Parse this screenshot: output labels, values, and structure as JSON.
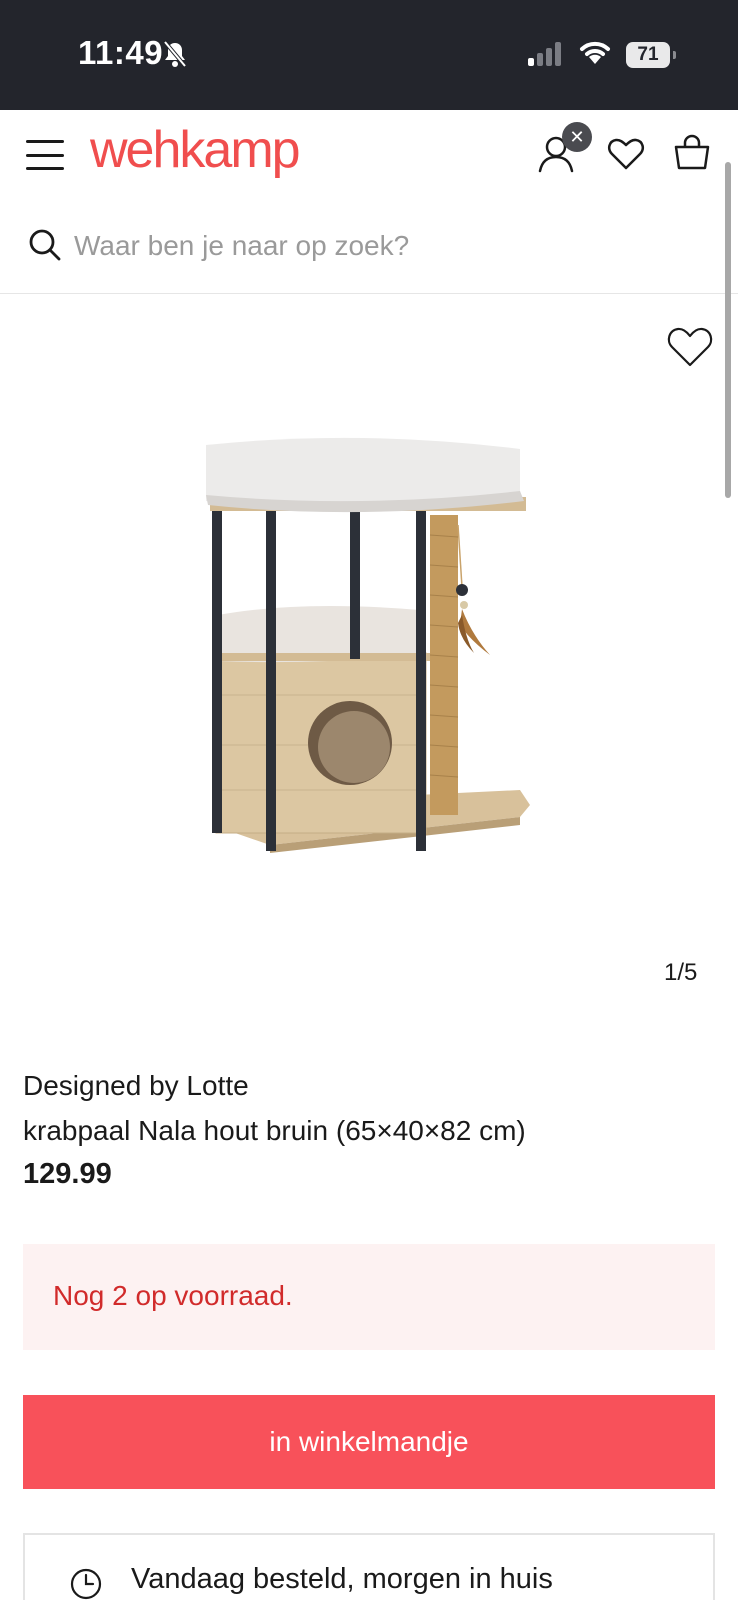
{
  "status_bar": {
    "time": "11:49",
    "battery": "71",
    "icons": [
      "bell-slash-icon",
      "cellular-signal-icon",
      "wifi-icon",
      "battery-icon"
    ]
  },
  "header": {
    "logo_text": "wehkamp",
    "account_badge": "✕",
    "icons": [
      "menu-icon",
      "account-icon",
      "heart-icon",
      "shopping-bag-icon"
    ]
  },
  "search": {
    "placeholder": "Waar ben je naar op zoek?"
  },
  "gallery": {
    "counter": "1/5",
    "icons": [
      "heart-outline-icon"
    ]
  },
  "product": {
    "brand": "Designed by Lotte",
    "name": "krabpaal Nala hout bruin (65×40×82 cm)",
    "price": "129.99"
  },
  "stock": {
    "message": "Nog 2 op voorraad."
  },
  "cart": {
    "button_label": "in winkelmandje"
  },
  "delivery": {
    "text": "Vandaag besteld, morgen in huis"
  },
  "colors": {
    "brand": "#f04e4e",
    "cart_button": "#f8515a",
    "stock_text": "#d12b2b",
    "stock_bg": "#fdf2f2",
    "status_bar": "#23252c"
  }
}
